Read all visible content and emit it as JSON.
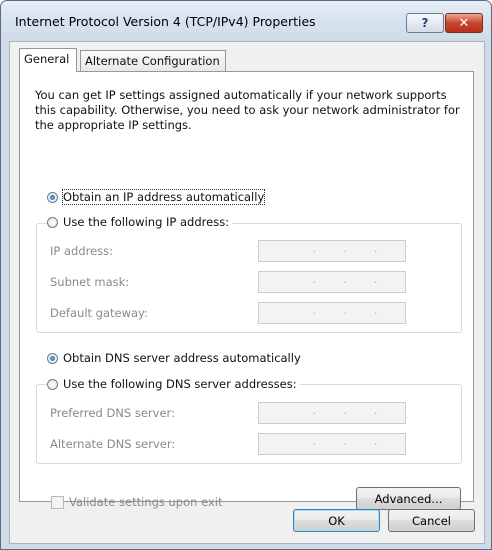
{
  "window": {
    "title": "Internet Protocol Version 4 (TCP/IPv4) Properties",
    "help_glyph": "?",
    "close_glyph": "✕"
  },
  "tabs": [
    {
      "label": "General",
      "selected": true
    },
    {
      "label": "Alternate Configuration",
      "selected": false
    }
  ],
  "general": {
    "info_text": "You can get IP settings assigned automatically if your network supports this capability. Otherwise, you need to ask your network administrator for the appropriate IP settings.",
    "ip_auto_label": "Obtain an IP address automatically",
    "ip_manual_label": "Use the following IP address:",
    "ip_fields": [
      {
        "label": "IP address:"
      },
      {
        "label": "Subnet mask:"
      },
      {
        "label": "Default gateway:"
      }
    ],
    "dns_auto_label": "Obtain DNS server address automatically",
    "dns_manual_label": "Use the following DNS server addresses:",
    "dns_fields": [
      {
        "label": "Preferred DNS server:"
      },
      {
        "label": "Alternate DNS server:"
      }
    ],
    "validate_label": "Validate settings upon exit",
    "advanced_label": "Advanced...",
    "ip_mode": "automatic",
    "dns_mode": "automatic",
    "validate_checked": false,
    "dot": "."
  },
  "footer": {
    "ok_label": "OK",
    "cancel_label": "Cancel"
  }
}
